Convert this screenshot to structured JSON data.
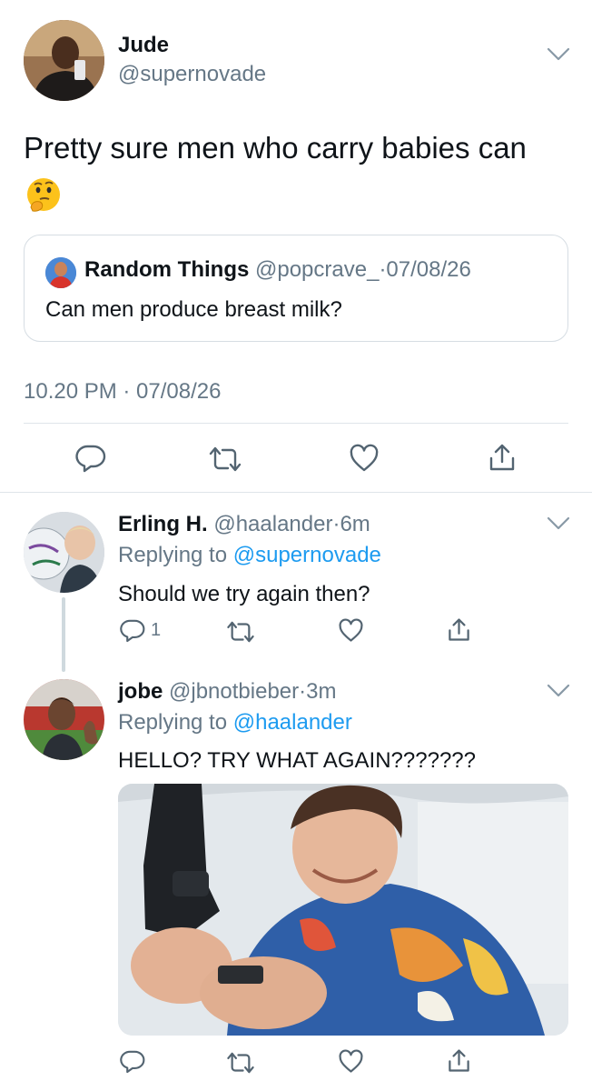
{
  "main_tweet": {
    "display_name": "Jude",
    "handle": "@supernovade",
    "text": "Pretty sure men who carry babies can",
    "emoji": "thinking-face",
    "timestamp": "10.20 PM · 07/08/26",
    "quote": {
      "display_name": "Random Things",
      "meta": "@popcrave_·07/08/26",
      "text": "Can men produce breast milk?"
    }
  },
  "replies": [
    {
      "display_name": "Erling H.",
      "meta": "@haalander·6m",
      "replying_prefix": "Replying to ",
      "replying_to": "@supernovade",
      "text": "Should we try again then?",
      "reply_count": "1"
    },
    {
      "display_name": "jobe",
      "meta": "@jbnotbieber·3m",
      "replying_prefix": "Replying to ",
      "replying_to": "@haalander",
      "text": "HELLO? TRY WHAT AGAIN???????",
      "reply_count": ""
    }
  ],
  "icons": {
    "reply": "reply-icon",
    "retweet": "retweet-icon",
    "like": "heart-icon",
    "share": "share-icon",
    "more": "chevron-down-icon"
  },
  "colors": {
    "text": "#0f1419",
    "secondary": "#657786",
    "link": "#1d9bf0",
    "divider": "#dfe5ea"
  }
}
